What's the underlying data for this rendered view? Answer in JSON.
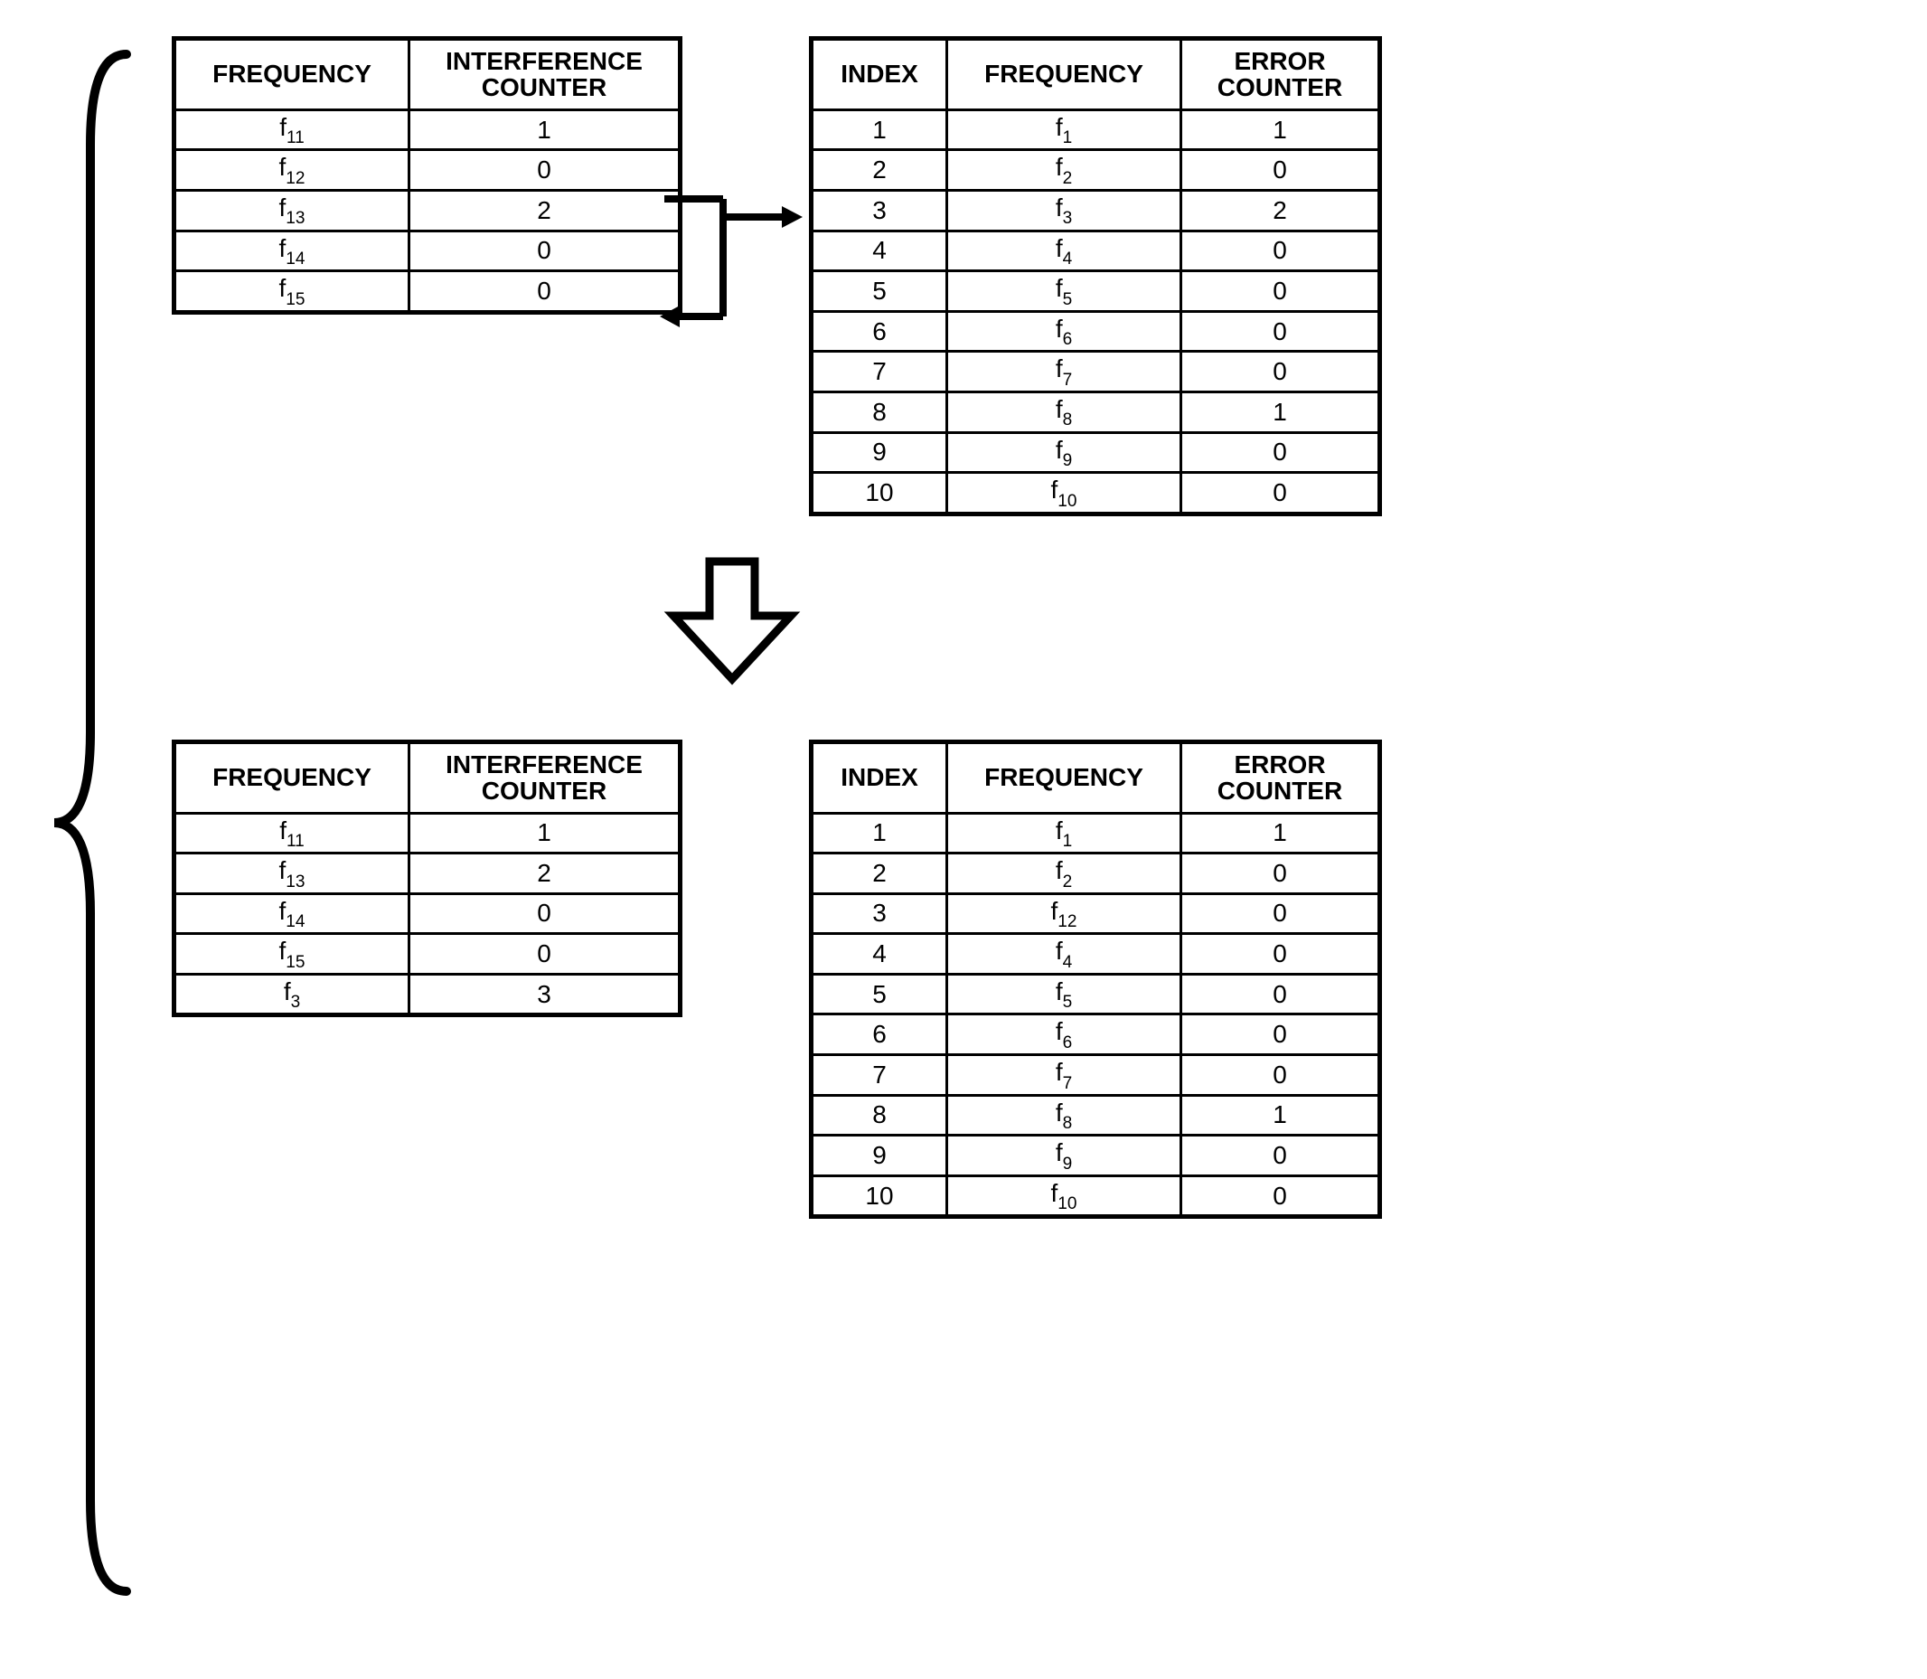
{
  "headers": {
    "frequency": "FREQUENCY",
    "interference_counter": "INTERFERENCE COUNTER",
    "index": "INDEX",
    "error_counter": "ERROR COUNTER"
  },
  "top_left": {
    "rows": [
      {
        "freq_base": "f",
        "freq_sub": "11",
        "counter": "1"
      },
      {
        "freq_base": "f",
        "freq_sub": "12",
        "counter": "0"
      },
      {
        "freq_base": "f",
        "freq_sub": "13",
        "counter": "2"
      },
      {
        "freq_base": "f",
        "freq_sub": "14",
        "counter": "0"
      },
      {
        "freq_base": "f",
        "freq_sub": "15",
        "counter": "0"
      }
    ]
  },
  "top_right": {
    "rows": [
      {
        "idx": "1",
        "freq_base": "f",
        "freq_sub": "1",
        "counter": "1"
      },
      {
        "idx": "2",
        "freq_base": "f",
        "freq_sub": "2",
        "counter": "0"
      },
      {
        "idx": "3",
        "freq_base": "f",
        "freq_sub": "3",
        "counter": "2"
      },
      {
        "idx": "4",
        "freq_base": "f",
        "freq_sub": "4",
        "counter": "0"
      },
      {
        "idx": "5",
        "freq_base": "f",
        "freq_sub": "5",
        "counter": "0"
      },
      {
        "idx": "6",
        "freq_base": "f",
        "freq_sub": "6",
        "counter": "0"
      },
      {
        "idx": "7",
        "freq_base": "f",
        "freq_sub": "7",
        "counter": "0"
      },
      {
        "idx": "8",
        "freq_base": "f",
        "freq_sub": "8",
        "counter": "1"
      },
      {
        "idx": "9",
        "freq_base": "f",
        "freq_sub": "9",
        "counter": "0"
      },
      {
        "idx": "10",
        "freq_base": "f",
        "freq_sub": "10",
        "counter": "0"
      }
    ]
  },
  "bottom_left": {
    "rows": [
      {
        "freq_base": "f",
        "freq_sub": "11",
        "counter": "1"
      },
      {
        "freq_base": "f",
        "freq_sub": "13",
        "counter": "2"
      },
      {
        "freq_base": "f",
        "freq_sub": "14",
        "counter": "0"
      },
      {
        "freq_base": "f",
        "freq_sub": "15",
        "counter": "0"
      },
      {
        "freq_base": "f",
        "freq_sub": "3",
        "counter": "3"
      }
    ]
  },
  "bottom_right": {
    "rows": [
      {
        "idx": "1",
        "freq_base": "f",
        "freq_sub": "1",
        "counter": "1"
      },
      {
        "idx": "2",
        "freq_base": "f",
        "freq_sub": "2",
        "counter": "0"
      },
      {
        "idx": "3",
        "freq_base": "f",
        "freq_sub": "12",
        "counter": "0"
      },
      {
        "idx": "4",
        "freq_base": "f",
        "freq_sub": "4",
        "counter": "0"
      },
      {
        "idx": "5",
        "freq_base": "f",
        "freq_sub": "5",
        "counter": "0"
      },
      {
        "idx": "6",
        "freq_base": "f",
        "freq_sub": "6",
        "counter": "0"
      },
      {
        "idx": "7",
        "freq_base": "f",
        "freq_sub": "7",
        "counter": "0"
      },
      {
        "idx": "8",
        "freq_base": "f",
        "freq_sub": "8",
        "counter": "1"
      },
      {
        "idx": "9",
        "freq_base": "f",
        "freq_sub": "9",
        "counter": "0"
      },
      {
        "idx": "10",
        "freq_base": "f",
        "freq_sub": "10",
        "counter": "0"
      }
    ]
  }
}
